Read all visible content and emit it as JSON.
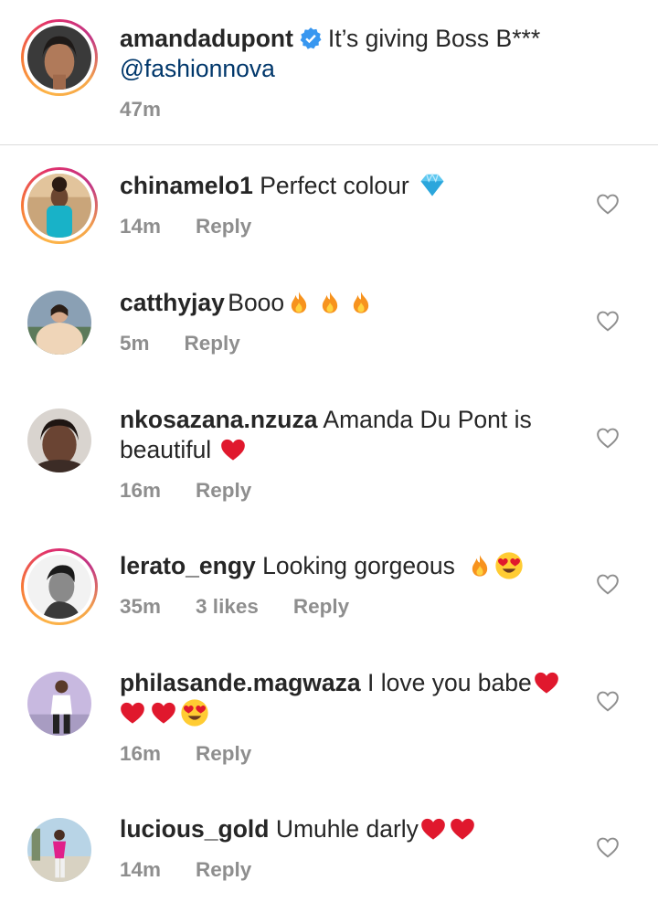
{
  "caption": {
    "username": "amandadupont",
    "text": "It’s giving Boss B***",
    "mention": "@fashionnova",
    "time": "47m"
  },
  "comments": [
    {
      "username": "chinamelo1",
      "text": "Perfect colour",
      "time": "14m",
      "likes": "",
      "reply": "Reply",
      "emojis": [
        "gem"
      ]
    },
    {
      "username": "catthyjay",
      "text": "Booo",
      "time": "5m",
      "likes": "",
      "reply": "Reply",
      "emojis": [
        "fire",
        "fire",
        "fire"
      ]
    },
    {
      "username": "nkosazana.nzuza",
      "text": "Amanda Du Pont is beautiful",
      "time": "16m",
      "likes": "",
      "reply": "Reply",
      "emojis": [
        "red-heart"
      ]
    },
    {
      "username": "lerato_engy",
      "text": "Looking gorgeous",
      "time": "35m",
      "likes": "3 likes",
      "reply": "Reply",
      "emojis": [
        "fire",
        "heart-eyes"
      ]
    },
    {
      "username": "philasande.magwaza",
      "text": "I love you babe",
      "time": "16m",
      "likes": "",
      "reply": "Reply",
      "emojis": [
        "red-heart",
        "red-heart",
        "red-heart",
        "heart-eyes"
      ]
    },
    {
      "username": "lucious_gold",
      "text": "Umuhle darly",
      "time": "14m",
      "likes": "",
      "reply": "Reply",
      "emojis": [
        "red-heart",
        "red-heart"
      ]
    }
  ],
  "colors": {
    "text": "#262626",
    "secondary": "#8e8e8e",
    "mention": "#00376b",
    "verified": "#3897f0",
    "divider": "#dbdbdb"
  }
}
